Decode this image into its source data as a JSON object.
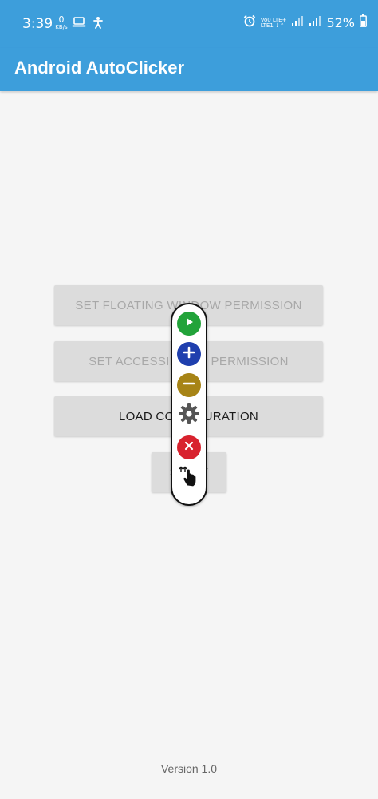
{
  "status_bar": {
    "time": "3:39",
    "kbs_value": "0",
    "kbs_unit": "KB/s",
    "lte_line1": "Vo0 LTE+",
    "lte_line2": "LTE1 ↓↑",
    "battery": "52%",
    "background_color": "#3d9edb"
  },
  "app_bar": {
    "title": "Android AutoClicker",
    "color": "#3d9edb"
  },
  "buttons": {
    "floating_window": "SET FLOATING WINDOW PERMISSION",
    "accessibility": "SET ACCESSIBILITY PERMISSION",
    "load_configuration": "LOAD CONFIGURATION",
    "start": "START"
  },
  "floating_toolbar": {
    "icons": [
      "play-icon",
      "add-icon",
      "remove-icon",
      "gear-icon",
      "close-icon",
      "move-pointer-icon"
    ],
    "colors": {
      "play": "#22a33a",
      "add": "#1f3fae",
      "remove": "#a78416",
      "settings": "#555555",
      "close": "#d8222e"
    }
  },
  "footer": {
    "version": "Version 1.0"
  }
}
